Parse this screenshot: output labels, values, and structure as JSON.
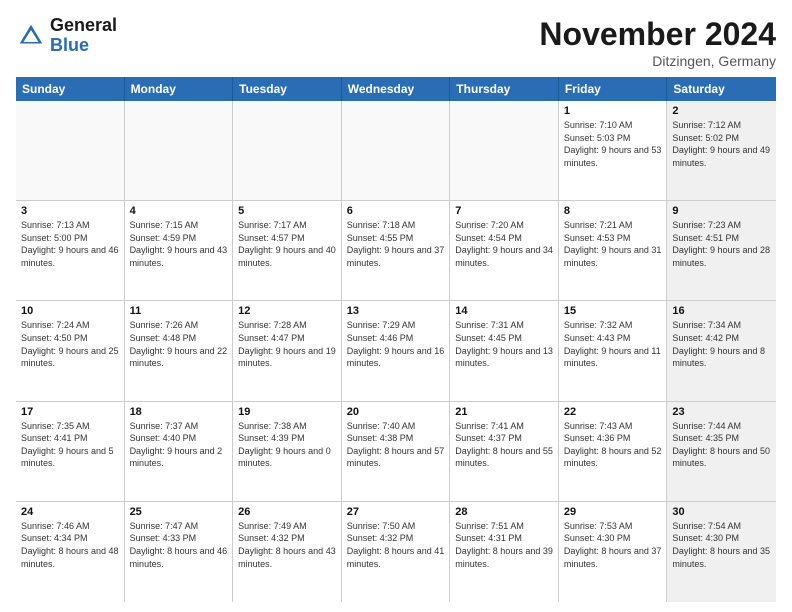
{
  "header": {
    "logo_general": "General",
    "logo_blue": "Blue",
    "month_title": "November 2024",
    "location": "Ditzingen, Germany"
  },
  "calendar": {
    "days_of_week": [
      "Sunday",
      "Monday",
      "Tuesday",
      "Wednesday",
      "Thursday",
      "Friday",
      "Saturday"
    ],
    "weeks": [
      [
        {
          "day": "",
          "info": "",
          "empty": true
        },
        {
          "day": "",
          "info": "",
          "empty": true
        },
        {
          "day": "",
          "info": "",
          "empty": true
        },
        {
          "day": "",
          "info": "",
          "empty": true
        },
        {
          "day": "",
          "info": "",
          "empty": true
        },
        {
          "day": "1",
          "info": "Sunrise: 7:10 AM\nSunset: 5:03 PM\nDaylight: 9 hours and 53 minutes.",
          "empty": false,
          "shaded": false
        },
        {
          "day": "2",
          "info": "Sunrise: 7:12 AM\nSunset: 5:02 PM\nDaylight: 9 hours and 49 minutes.",
          "empty": false,
          "shaded": true
        }
      ],
      [
        {
          "day": "3",
          "info": "Sunrise: 7:13 AM\nSunset: 5:00 PM\nDaylight: 9 hours and 46 minutes.",
          "empty": false,
          "shaded": false
        },
        {
          "day": "4",
          "info": "Sunrise: 7:15 AM\nSunset: 4:59 PM\nDaylight: 9 hours and 43 minutes.",
          "empty": false,
          "shaded": false
        },
        {
          "day": "5",
          "info": "Sunrise: 7:17 AM\nSunset: 4:57 PM\nDaylight: 9 hours and 40 minutes.",
          "empty": false,
          "shaded": false
        },
        {
          "day": "6",
          "info": "Sunrise: 7:18 AM\nSunset: 4:55 PM\nDaylight: 9 hours and 37 minutes.",
          "empty": false,
          "shaded": false
        },
        {
          "day": "7",
          "info": "Sunrise: 7:20 AM\nSunset: 4:54 PM\nDaylight: 9 hours and 34 minutes.",
          "empty": false,
          "shaded": false
        },
        {
          "day": "8",
          "info": "Sunrise: 7:21 AM\nSunset: 4:53 PM\nDaylight: 9 hours and 31 minutes.",
          "empty": false,
          "shaded": false
        },
        {
          "day": "9",
          "info": "Sunrise: 7:23 AM\nSunset: 4:51 PM\nDaylight: 9 hours and 28 minutes.",
          "empty": false,
          "shaded": true
        }
      ],
      [
        {
          "day": "10",
          "info": "Sunrise: 7:24 AM\nSunset: 4:50 PM\nDaylight: 9 hours and 25 minutes.",
          "empty": false,
          "shaded": false
        },
        {
          "day": "11",
          "info": "Sunrise: 7:26 AM\nSunset: 4:48 PM\nDaylight: 9 hours and 22 minutes.",
          "empty": false,
          "shaded": false
        },
        {
          "day": "12",
          "info": "Sunrise: 7:28 AM\nSunset: 4:47 PM\nDaylight: 9 hours and 19 minutes.",
          "empty": false,
          "shaded": false
        },
        {
          "day": "13",
          "info": "Sunrise: 7:29 AM\nSunset: 4:46 PM\nDaylight: 9 hours and 16 minutes.",
          "empty": false,
          "shaded": false
        },
        {
          "day": "14",
          "info": "Sunrise: 7:31 AM\nSunset: 4:45 PM\nDaylight: 9 hours and 13 minutes.",
          "empty": false,
          "shaded": false
        },
        {
          "day": "15",
          "info": "Sunrise: 7:32 AM\nSunset: 4:43 PM\nDaylight: 9 hours and 11 minutes.",
          "empty": false,
          "shaded": false
        },
        {
          "day": "16",
          "info": "Sunrise: 7:34 AM\nSunset: 4:42 PM\nDaylight: 9 hours and 8 minutes.",
          "empty": false,
          "shaded": true
        }
      ],
      [
        {
          "day": "17",
          "info": "Sunrise: 7:35 AM\nSunset: 4:41 PM\nDaylight: 9 hours and 5 minutes.",
          "empty": false,
          "shaded": false
        },
        {
          "day": "18",
          "info": "Sunrise: 7:37 AM\nSunset: 4:40 PM\nDaylight: 9 hours and 2 minutes.",
          "empty": false,
          "shaded": false
        },
        {
          "day": "19",
          "info": "Sunrise: 7:38 AM\nSunset: 4:39 PM\nDaylight: 9 hours and 0 minutes.",
          "empty": false,
          "shaded": false
        },
        {
          "day": "20",
          "info": "Sunrise: 7:40 AM\nSunset: 4:38 PM\nDaylight: 8 hours and 57 minutes.",
          "empty": false,
          "shaded": false
        },
        {
          "day": "21",
          "info": "Sunrise: 7:41 AM\nSunset: 4:37 PM\nDaylight: 8 hours and 55 minutes.",
          "empty": false,
          "shaded": false
        },
        {
          "day": "22",
          "info": "Sunrise: 7:43 AM\nSunset: 4:36 PM\nDaylight: 8 hours and 52 minutes.",
          "empty": false,
          "shaded": false
        },
        {
          "day": "23",
          "info": "Sunrise: 7:44 AM\nSunset: 4:35 PM\nDaylight: 8 hours and 50 minutes.",
          "empty": false,
          "shaded": true
        }
      ],
      [
        {
          "day": "24",
          "info": "Sunrise: 7:46 AM\nSunset: 4:34 PM\nDaylight: 8 hours and 48 minutes.",
          "empty": false,
          "shaded": false
        },
        {
          "day": "25",
          "info": "Sunrise: 7:47 AM\nSunset: 4:33 PM\nDaylight: 8 hours and 46 minutes.",
          "empty": false,
          "shaded": false
        },
        {
          "day": "26",
          "info": "Sunrise: 7:49 AM\nSunset: 4:32 PM\nDaylight: 8 hours and 43 minutes.",
          "empty": false,
          "shaded": false
        },
        {
          "day": "27",
          "info": "Sunrise: 7:50 AM\nSunset: 4:32 PM\nDaylight: 8 hours and 41 minutes.",
          "empty": false,
          "shaded": false
        },
        {
          "day": "28",
          "info": "Sunrise: 7:51 AM\nSunset: 4:31 PM\nDaylight: 8 hours and 39 minutes.",
          "empty": false,
          "shaded": false
        },
        {
          "day": "29",
          "info": "Sunrise: 7:53 AM\nSunset: 4:30 PM\nDaylight: 8 hours and 37 minutes.",
          "empty": false,
          "shaded": false
        },
        {
          "day": "30",
          "info": "Sunrise: 7:54 AM\nSunset: 4:30 PM\nDaylight: 8 hours and 35 minutes.",
          "empty": false,
          "shaded": true
        }
      ]
    ]
  }
}
